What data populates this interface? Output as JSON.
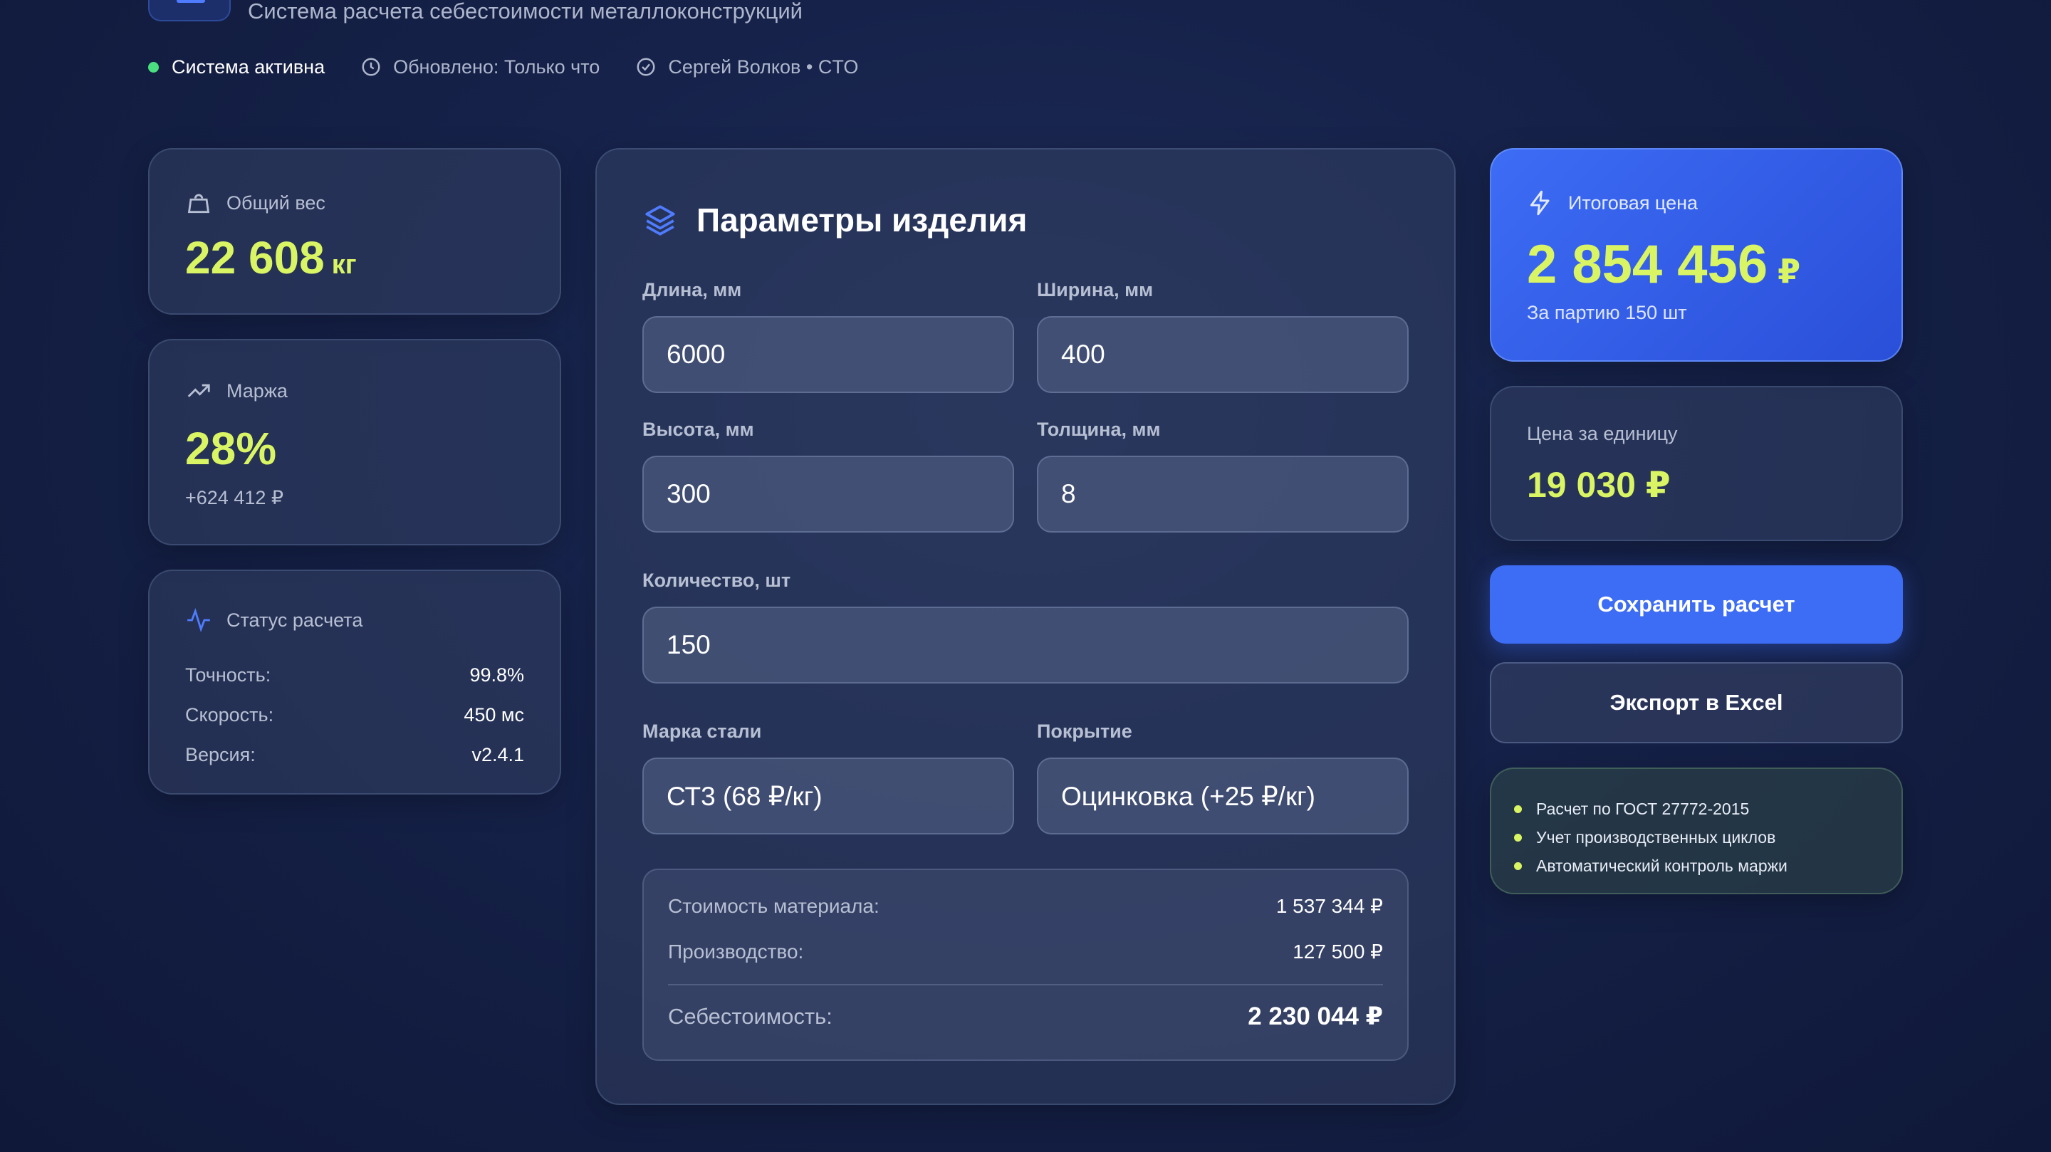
{
  "header": {
    "subtitle": "Система расчета себестоимости металлоконструкций",
    "status": {
      "system": "Система активна",
      "updated": "Обновлено: Только что",
      "user": "Сергей Волков • CTO"
    }
  },
  "weight": {
    "label": "Общий вес",
    "value": "22 608",
    "unit": "кг"
  },
  "margin": {
    "label": "Маржа",
    "value": "28%",
    "sub": "+624 412 ₽"
  },
  "status_card": {
    "label": "Статус расчета",
    "rows": [
      {
        "key": "Точность:",
        "value": "99.8%"
      },
      {
        "key": "Скорость:",
        "value": "450 мс"
      },
      {
        "key": "Версия:",
        "value": "v2.4.1"
      }
    ]
  },
  "params": {
    "title": "Параметры изделия",
    "length": {
      "label": "Длина, мм",
      "value": "6000"
    },
    "width": {
      "label": "Ширина, мм",
      "value": "400"
    },
    "height": {
      "label": "Высота, мм",
      "value": "300"
    },
    "thickness": {
      "label": "Толщина, мм",
      "value": "8"
    },
    "quantity": {
      "label": "Количество, шт",
      "value": "150"
    },
    "steel": {
      "label": "Марка стали",
      "value": "СТ3 (68 ₽/кг)"
    },
    "coating": {
      "label": "Покрытие",
      "value": "Оцинковка (+25 ₽/кг)"
    }
  },
  "summary": {
    "material": {
      "label": "Стоимость материала:",
      "value": "1 537 344 ₽"
    },
    "production": {
      "label": "Производство:",
      "value": "127 500 ₽"
    },
    "cost": {
      "label": "Себестоимость:",
      "value": "2 230 044 ₽"
    }
  },
  "total": {
    "label": "Итоговая цена",
    "value": "2 854 456",
    "currency": "₽",
    "sub": "За партию 150 шт"
  },
  "unit_price": {
    "label": "Цена за единицу",
    "value": "19 030 ₽"
  },
  "buttons": {
    "save": "Сохранить расчет",
    "export": "Экспорт в Excel"
  },
  "notes": [
    "Расчет по ГОСТ 27772-2015",
    "Учет производственных циклов",
    "Автоматический контроль маржи"
  ],
  "colors": {
    "accent": "#d9f564",
    "primary": "#3d6cf5",
    "status_active": "#4ade80",
    "background": "#16224a"
  }
}
